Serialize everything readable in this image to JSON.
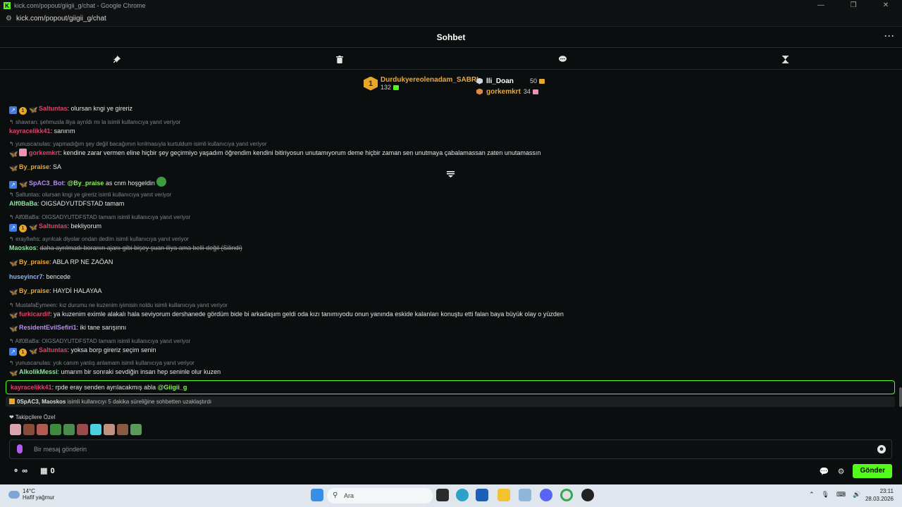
{
  "browser": {
    "window_title": "kick.com/popout/giigii_g/chat - Google Chrome",
    "url": "kick.com/popout/giigii_g/chat",
    "controls": [
      "—",
      "❐",
      "✕"
    ]
  },
  "header": {
    "title": "Sohbet",
    "more": "···"
  },
  "toolbar": {
    "icons": [
      "pin-icon",
      "trash-icon",
      "chat-bubble-icon",
      "hourglass-icon"
    ]
  },
  "leaderboard": {
    "first": {
      "rank": "1",
      "name": "Durdukyereolenadam_SABRI",
      "points": "132"
    },
    "second": {
      "name": "lli_Doan",
      "points": "50"
    },
    "third": {
      "name": "gorkemkrt",
      "points": "34"
    }
  },
  "messages": [
    {
      "id": "m0",
      "user": "Saltuntas",
      "text": ": olursan kngi ye gireriz",
      "color": "#e0426b"
    },
    {
      "id": "m1",
      "reply": "shawran: şehmusla iliya ayrıldı mı la isimli kullanıcıya yanıt veriyor",
      "user": "kayracelikk41",
      "text": ": sanırım",
      "color": "#e0426b"
    },
    {
      "id": "m2",
      "reply": "yunuscanulas: yapmadığım şey değil bacağımın kırılmasıyla kurtuldum isimli kullanıcıya yanıt veriyor",
      "user": "gorkemkrt",
      "text": ": kendine zarar vermen eline hiçbir şey geçirmiyo yaşadım öğrendim kendini bitiriyosun unutamıyorum deme hiçbir zaman sen unutmaya çabalamassan zaten unutamassın",
      "color": "#e0426b"
    },
    {
      "id": "m3",
      "user": "By_praise",
      "text": ": SA",
      "color": "#e8a93c"
    },
    {
      "id": "m4",
      "user": "SpAC3_Bot",
      "mention": "@By_praise",
      "text": " as cnm hoşgeldin",
      "color": "#b98bf5"
    },
    {
      "id": "m5",
      "reply": "Saltuntas: olursan kngi ye gireriz isimli kullanıcıya yanıt veriyor",
      "user": "Alf0BaBa",
      "text": ": OIGSADYUTDFSTAD tamam",
      "color": "#8fe3a0"
    },
    {
      "id": "m6",
      "reply": "Alf0BaBa: OIGSADYUTDFSTAD tamam isimli kullanıcıya yanıt veriyor",
      "user": "Saltuntas",
      "text": ": bekliyorum",
      "color": "#e0426b"
    },
    {
      "id": "m7",
      "reply": "erayfiwhs: ayrılcak diyolar ondan dedim isimli kullanıcıya yanıt veriyor",
      "user": "Maoskos",
      "text": "daha ayrılmadı boranın ajanı gibi bişey şuan iliya ama belli değil (Silindi)",
      "color": "#8fe3a0"
    },
    {
      "id": "m8",
      "user": "By_praise",
      "text": ": ABLA RP NE ZAÖAN",
      "color": "#e8a93c"
    },
    {
      "id": "m9",
      "user": "huseyincr7",
      "text": ": bencede",
      "color": "#8ab4f8"
    },
    {
      "id": "m10",
      "user": "By_praise",
      "text": ": HAYDİ HALAYAA",
      "color": "#e8a93c"
    },
    {
      "id": "m11",
      "reply": "MustafaEymeen: kız durumu ne kuzenim iyimisin noldu isimli kullanıcıya yanıt veriyor",
      "user": "furkicardif",
      "text": ": ya kuzenim eximle alakalı hala seviyorum dershanede gördüm bide bi arkadaşım geldi oda kızı tanımıyodu onun yanında eskide kalanları konuştu etti falan baya büyük olay o yüzden",
      "color": "#e0426b"
    },
    {
      "id": "m12",
      "user": "ResidentEvilSefiri1",
      "text": ": iki tane sarışınnı",
      "color": "#b98bf5"
    },
    {
      "id": "m13",
      "reply": "Alf0BaBa: OIGSADYUTDFSTAD tamam isimli kullanıcıya yanıt veriyor",
      "user": "Saltuntas",
      "text": ": yoksa borp gireriz seçim senin",
      "color": "#e0426b"
    },
    {
      "id": "m14",
      "reply": "yunuscanulas: yok canım yanlış anlamam isimli kullanıcıya yanıt veriyor",
      "user": "AlkolikMessi",
      "text": ": umarım bir sonraki sevdiğin insan hep seninle olur kuzen",
      "color": "#8fe3a0"
    }
  ],
  "pinned": {
    "user": "kayracelikk41",
    "text": ": rpde eray senden ayrılacakmış abla ",
    "mention": "@Giigii_g"
  },
  "timeout": {
    "users": "0SpAC3, Maoskos",
    "text": " isimli kullanıcıyı 5 dakika süreliğine sohbetten uzaklaştırdı"
  },
  "followers": {
    "label": "Takipçilere Özel"
  },
  "input": {
    "placeholder": "Bir mesaj gönderin"
  },
  "bottom": {
    "infinity": "∞",
    "count": "0",
    "send": "Gönder"
  },
  "taskbar": {
    "temp": "14°C",
    "weather": "Hafif yağmur",
    "search": "Ara",
    "time": "23:11",
    "date": "28.03.2026"
  }
}
